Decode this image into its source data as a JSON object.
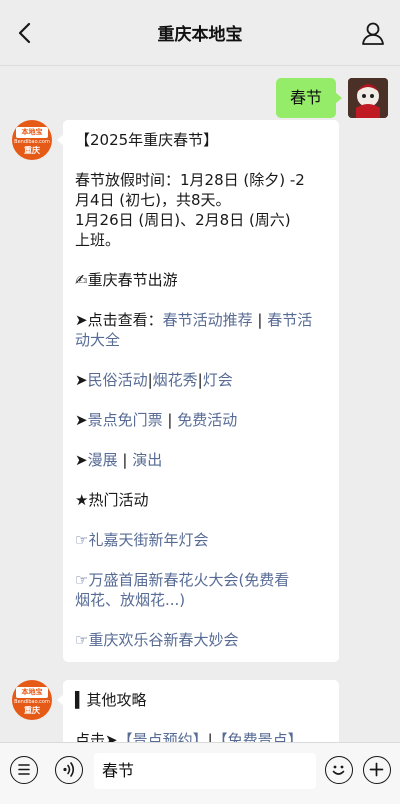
{
  "header": {
    "title": "重庆本地宝"
  },
  "me": {
    "message": "春节"
  },
  "bot": {
    "avatar_tag": "本地宝",
    "avatar_site": "Bendibao.com",
    "avatar_city": "重庆",
    "msg1": {
      "title": "【2025年重庆春节】",
      "holiday_line1": "春节放假时间：1月28日 (除夕) -2",
      "holiday_line2": "月4日 (初七)，共8天。",
      "work_line1": "1月26日 (周日)、2月8日 (周六)",
      "work_line2": "上班。",
      "travel_heading": "✍重庆春节出游",
      "check_prefix": "➤点击查看：",
      "link_events_a": "春节活动推荐",
      "sep": " | ",
      "link_events_b1": "春节活",
      "link_events_b2": "动大全",
      "arrow": "➤",
      "link_folk": "民俗活动",
      "bar": "|",
      "link_fireworks": "烟花秀",
      "link_lantern": "灯会",
      "link_free_tickets": "景点免门票",
      "link_free_events": "免费活动",
      "link_comic": "漫展",
      "link_show": "演出",
      "hot_heading": "★热门活动",
      "hot1": "☞礼嘉天街新年灯会",
      "hot2_line1": "☞万盛首届新春花火大会(免费看",
      "hot2_line2": "烟花、放烟花...)",
      "hot3": "☞重庆欢乐谷新春大妙会"
    },
    "msg2": {
      "title": "▍其他攻略",
      "click_prefix": "点击➤",
      "link_booking": "【景点预约】",
      "bar": "|",
      "link_free_spots": "【免费景点】"
    }
  },
  "inputbar": {
    "text": "春节"
  },
  "colors": {
    "link": "#576b95",
    "my_bubble": "#95ec69",
    "brand": "#e65a17"
  }
}
